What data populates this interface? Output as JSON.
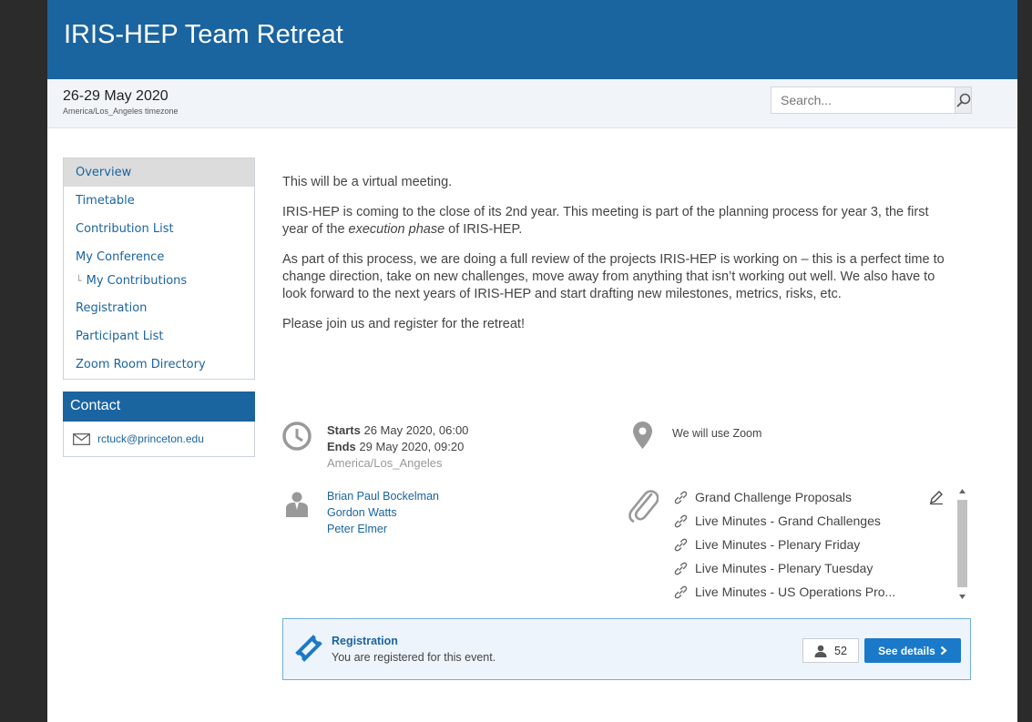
{
  "header": {
    "title": "IRIS-HEP Team Retreat"
  },
  "subheader": {
    "date": "26-29 May 2020",
    "timezone": "America/Los_Angeles timezone"
  },
  "search": {
    "placeholder": "Search..."
  },
  "menu": {
    "items": [
      {
        "label": "Overview"
      },
      {
        "label": "Timetable"
      },
      {
        "label": "Contribution List"
      },
      {
        "label": "My Conference"
      },
      {
        "label": "My Contributions"
      },
      {
        "label": "Registration"
      },
      {
        "label": "Participant List"
      },
      {
        "label": "Zoom Room Directory"
      }
    ]
  },
  "contact": {
    "title": "Contact",
    "email": "rctuck@princeton.edu"
  },
  "description": {
    "p1": "This will be a virtual meeting.",
    "p2a": "IRIS-HEP is coming to the close of its 2nd year. This meeting is part of the planning process for year 3, the first year of the ",
    "p2em": "execution phase",
    "p2b": " of IRIS-HEP.",
    "p3": "As part of this process, we are doing a full review of the projects IRIS-HEP is working on – this is a perfect time to change direction, take on new challenges, move away from anything that isn’t working out well. We also have to look forward to the next years of IRIS-HEP and start drafting new milestones, metrics, risks, etc.",
    "p4": "Please join us and register for the retreat!"
  },
  "dates": {
    "starts_label": "Starts",
    "starts_value": "26 May 2020, 06:00",
    "ends_label": "Ends",
    "ends_value": "29 May 2020, 09:20",
    "tz": "America/Los_Angeles"
  },
  "location": {
    "text": "We will use Zoom"
  },
  "chairs": [
    "Brian Paul Bockelman",
    "Gordon Watts",
    "Peter Elmer"
  ],
  "materials": [
    "Grand Challenge Proposals",
    "Live Minutes - Grand Challenges",
    "Live Minutes - Plenary Friday",
    "Live Minutes - Plenary Tuesday",
    "Live Minutes - US Operations Pro..."
  ],
  "registration": {
    "title": "Registration",
    "text": "You are registered for this event.",
    "count": "52",
    "details_label": "See details"
  },
  "colors": {
    "brand": "#1a64a0",
    "button": "#1a7ac9"
  }
}
